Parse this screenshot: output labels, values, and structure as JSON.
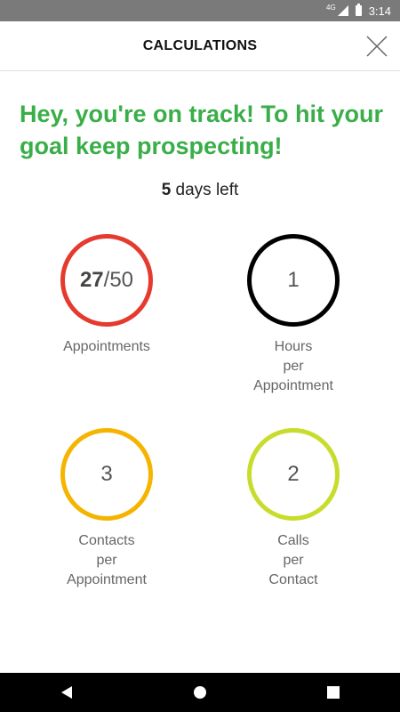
{
  "status_bar": {
    "network": "4G",
    "time": "3:14",
    "icons": [
      "signal-icon",
      "battery-icon"
    ]
  },
  "header": {
    "title": "CALCULATIONS",
    "close_icon": "close-icon"
  },
  "message": "Hey, you're on track! To hit your goal keep prospecting!",
  "days_left": {
    "value": "5",
    "suffix": " days left"
  },
  "metrics": [
    {
      "value_strong": "27",
      "value_rest": "/50",
      "label_lines": [
        "Appointments"
      ],
      "color": "#e53a2e"
    },
    {
      "value_strong": "",
      "value_rest": "1",
      "label_lines": [
        "Hours",
        "per",
        "Appointment"
      ],
      "color": "#000000"
    },
    {
      "value_strong": "",
      "value_rest": "3",
      "label_lines": [
        "Contacts",
        "per",
        "Appointment"
      ],
      "color": "#f5b400"
    },
    {
      "value_strong": "",
      "value_rest": "2",
      "label_lines": [
        "Calls",
        "per",
        "Contact"
      ],
      "color": "#c8dc2c"
    }
  ],
  "colors": {
    "accent_green": "#3aae49",
    "status_bar": "#7a7a7a"
  },
  "nav_bar": {
    "icons": [
      "back-icon",
      "home-icon",
      "recents-icon"
    ]
  }
}
